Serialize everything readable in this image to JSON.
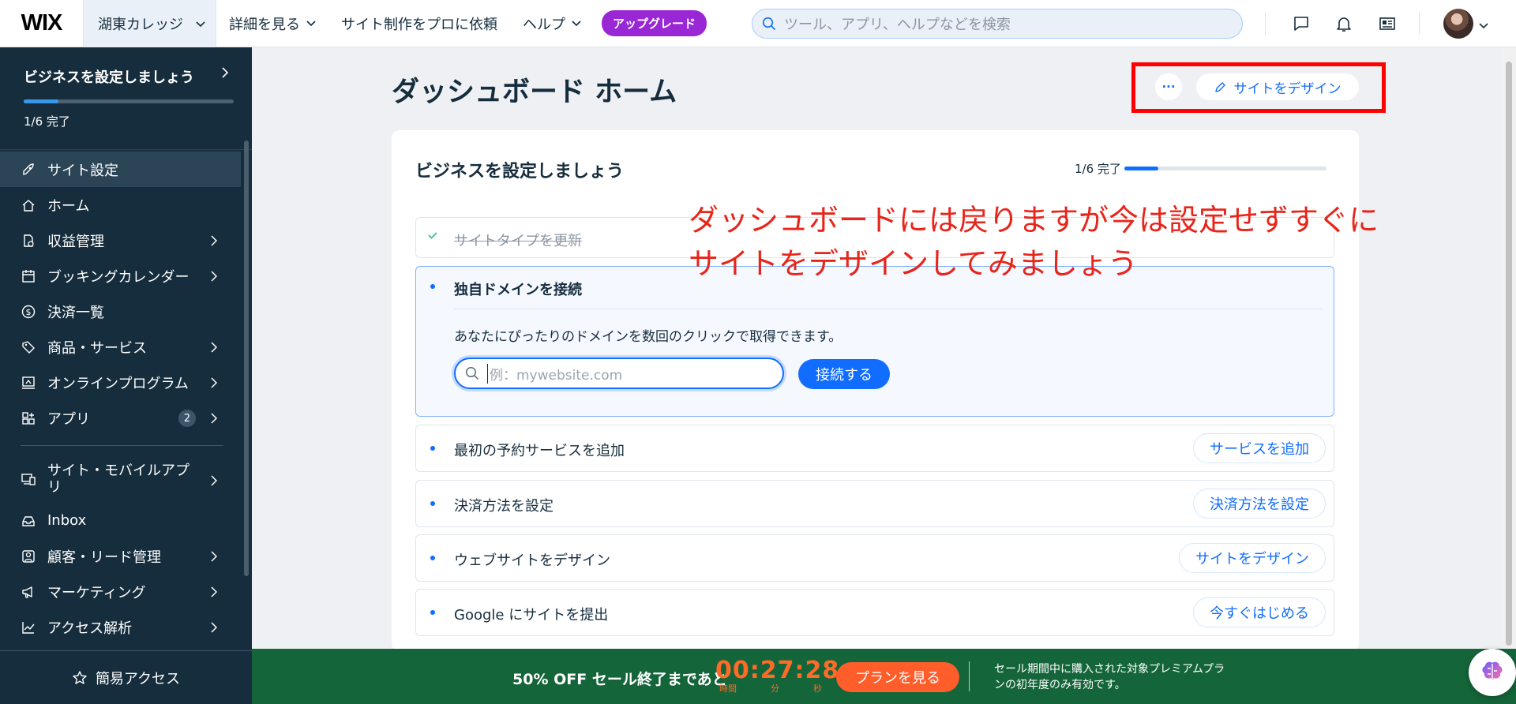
{
  "app": {
    "logo": "WIX",
    "site_name": "湖東カレッジ",
    "nav": {
      "more": "詳細を見る",
      "hire": "サイト制作をプロに依頼",
      "help": "ヘルプ",
      "upgrade": "アップグレード"
    },
    "search_placeholder": "ツール、アプリ、ヘルプなどを検索",
    "icons": [
      "chat-icon",
      "bell-icon",
      "news-icon",
      "avatar"
    ]
  },
  "sidebar": {
    "setup_title": "ビジネスを設定しましょう",
    "setup_progress_text": "1/6 完了",
    "setup_progress": 0.1667,
    "items": [
      {
        "label": "サイト設定",
        "icon": "rocket-icon",
        "active": true
      },
      {
        "label": "ホーム",
        "icon": "home-icon"
      },
      {
        "label": "収益管理",
        "icon": "revenue-icon",
        "chevron": true
      },
      {
        "label": "ブッキングカレンダー",
        "icon": "calendar-icon",
        "chevron": true
      },
      {
        "label": "決済一覧",
        "icon": "dollar-icon"
      },
      {
        "label": "商品・サービス",
        "icon": "tag-icon",
        "chevron": true
      },
      {
        "label": "オンラインプログラム",
        "icon": "program-icon",
        "chevron": true
      },
      {
        "label": "アプリ",
        "icon": "apps-icon",
        "chevron": true,
        "badge": "2"
      },
      {
        "label": "サイト・モバイルアプリ",
        "icon": "devices-icon",
        "chevron": true
      },
      {
        "label": "Inbox",
        "icon": "inbox-icon"
      },
      {
        "label": "顧客・リード管理",
        "icon": "contacts-icon",
        "chevron": true
      },
      {
        "label": "マーケティング",
        "icon": "megaphone-icon",
        "chevron": true
      },
      {
        "label": "アクセス解析",
        "icon": "analytics-icon",
        "chevron": true
      }
    ],
    "quick_access": "簡易アクセス"
  },
  "main": {
    "page_title": "ダッシュボード ホーム",
    "more_button": "···",
    "design_button": "サイトをデザイン",
    "card": {
      "title": "ビジネスを設定しましょう",
      "progress_text": "1/6 完了",
      "progress": 0.1667,
      "tasks": [
        {
          "label": "サイトタイプを更新",
          "status": "done"
        },
        {
          "label": "独自ドメインを接続",
          "status": "open",
          "description": "あなたにぴったりのドメインを数回のクリックで取得できます。",
          "input_placeholder": "例：mywebsite.com",
          "button": "接続する"
        },
        {
          "label": "最初の予約サービスを追加",
          "button": "サービスを追加"
        },
        {
          "label": "決済方法を設定",
          "button": "決済方法を設定"
        },
        {
          "label": "ウェブサイトをデザイン",
          "button": "サイトをデザイン"
        },
        {
          "label": "Google にサイトを提出",
          "button": "今すぐはじめる"
        }
      ]
    },
    "annotation": {
      "line1": "ダッシュボードには戻りますが今は設定せずすぐに",
      "line2": "サイトをデザインしてみましょう",
      "color": "#e8251b"
    }
  },
  "promo": {
    "headline": "50% OFF セール終了まであと",
    "timer": "00:27:28",
    "unit_hours": "時間",
    "unit_minutes": "分",
    "unit_seconds": "秒",
    "button": "プランを見る",
    "note": "セール期間中に購入された対象プレミアムプランの初年度のみ有効です。"
  },
  "colors": {
    "accent": "#116dff",
    "sidebar_bg": "#162d3d",
    "upgrade": "#9a27d5",
    "promo_bg": "#15653a",
    "promo_accent": "#ff5e2b",
    "highlight_box": "#ff0000"
  }
}
